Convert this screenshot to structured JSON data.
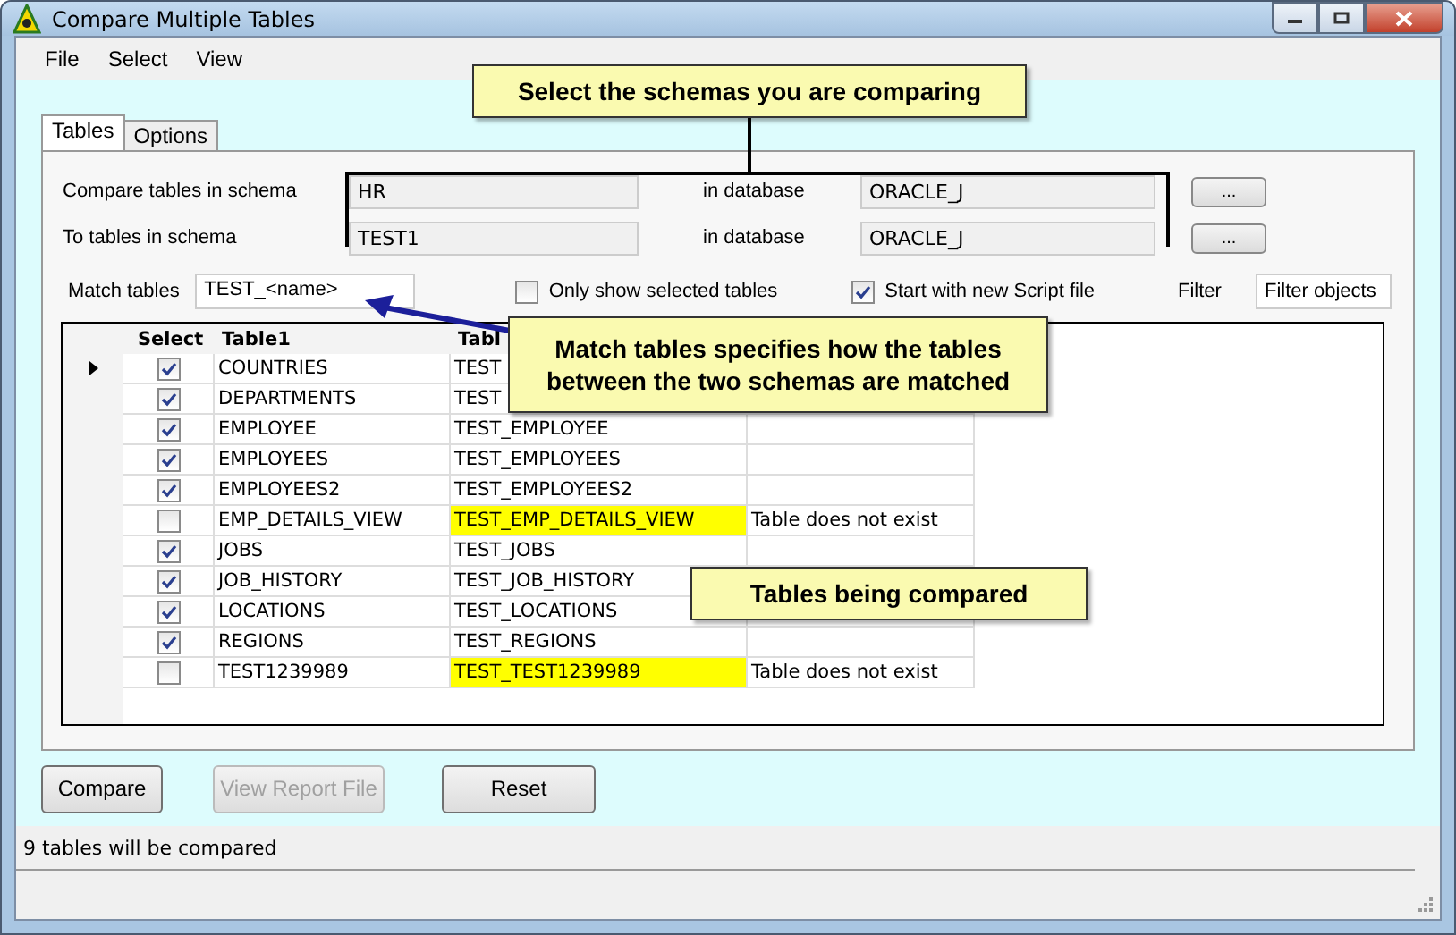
{
  "window": {
    "title": "Compare Multiple Tables"
  },
  "menu": [
    "File",
    "Select",
    "View"
  ],
  "tabs": [
    {
      "label": "Tables",
      "selected": true
    },
    {
      "label": "Options",
      "selected": false
    }
  ],
  "schema_rows": [
    {
      "label": "Compare tables in schema",
      "schema": "HR",
      "db_label": "in database",
      "database": "ORACLE_J",
      "button": "..."
    },
    {
      "label": "To tables in schema",
      "schema": "TEST1",
      "db_label": "in database",
      "database": "ORACLE_J",
      "button": "..."
    }
  ],
  "match": {
    "label": "Match tables",
    "value": "TEST_<name>"
  },
  "options": [
    {
      "label": "Only show selected tables",
      "checked": false
    },
    {
      "label": "Start with new Script file",
      "checked": true
    }
  ],
  "filter": {
    "label": "Filter",
    "placeholder": "Filter objects"
  },
  "table": {
    "columns": [
      "Select",
      "Table1",
      "Tabl"
    ],
    "rows": [
      {
        "current": true,
        "checked": true,
        "table1": "COUNTRIES",
        "table2": "TEST",
        "highlighted": false
      },
      {
        "current": false,
        "checked": true,
        "table1": "DEPARTMENTS",
        "table2": "TEST",
        "highlighted": false
      },
      {
        "current": false,
        "checked": true,
        "table1": "EMPLOYEE",
        "table2": "TEST_EMPLOYEE",
        "highlighted": false
      },
      {
        "current": false,
        "checked": true,
        "table1": "EMPLOYEES",
        "table2": "TEST_EMPLOYEES",
        "highlighted": false
      },
      {
        "current": false,
        "checked": true,
        "table1": "EMPLOYEES2",
        "table2": "TEST_EMPLOYEES2",
        "highlighted": false
      },
      {
        "current": false,
        "checked": false,
        "table1": "EMP_DETAILS_VIEW",
        "table2": "TEST_EMP_DETAILS_VIEW",
        "highlighted": true,
        "comment": "Table does not exist"
      },
      {
        "current": false,
        "checked": true,
        "table1": "JOBS",
        "table2": "TEST_JOBS",
        "highlighted": false
      },
      {
        "current": false,
        "checked": true,
        "table1": "JOB_HISTORY",
        "table2": "TEST_JOB_HISTORY",
        "highlighted": false
      },
      {
        "current": false,
        "checked": true,
        "table1": "LOCATIONS",
        "table2": "TEST_LOCATIONS",
        "highlighted": false
      },
      {
        "current": false,
        "checked": true,
        "table1": "REGIONS",
        "table2": "TEST_REGIONS",
        "highlighted": false
      },
      {
        "current": false,
        "checked": false,
        "table1": "TEST1239989",
        "table2": "TEST_TEST1239989",
        "highlighted": true,
        "comment": "Table does not exist"
      }
    ]
  },
  "buttons": [
    {
      "label": "Compare",
      "disabled": false
    },
    {
      "label": "View Report File",
      "disabled": true
    },
    {
      "label": "Reset",
      "disabled": false
    }
  ],
  "status_bar": "9 tables will be compared",
  "callouts": [
    "Select the schemas you are comparing",
    "Match tables specifies how the tables between the two schemas are matched",
    "Tables being compared"
  ]
}
